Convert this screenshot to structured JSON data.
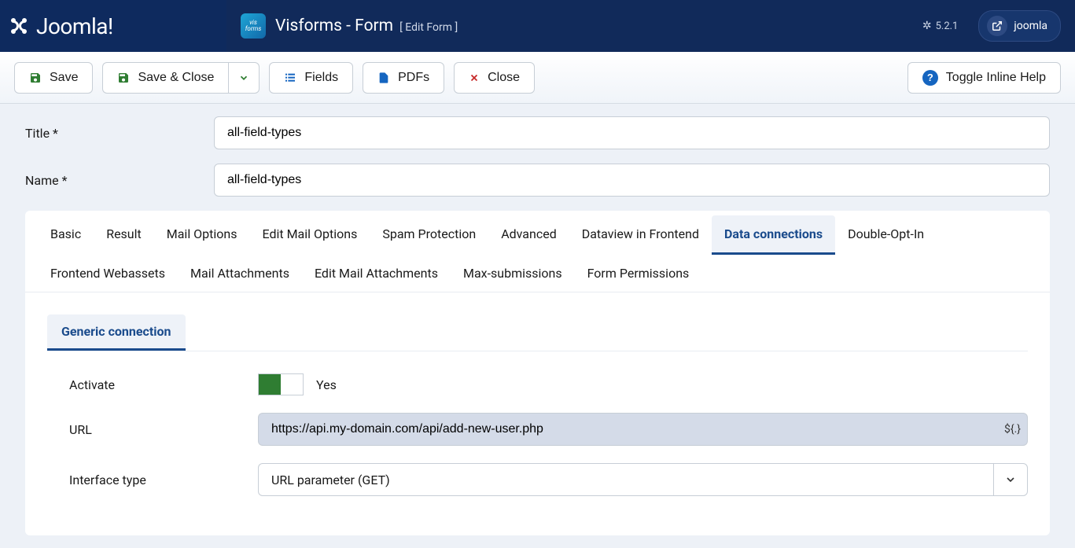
{
  "header": {
    "brand": "Joomla!",
    "title": "Visforms - Form",
    "subtitle": "[ Edit Form ]",
    "version": "5.2.1",
    "site_name": "joomla"
  },
  "toolbar": {
    "save": "Save",
    "save_close": "Save & Close",
    "fields": "Fields",
    "pdfs": "PDFs",
    "close": "Close",
    "toggle_help": "Toggle Inline Help"
  },
  "form": {
    "title_label": "Title *",
    "title_value": "all-field-types",
    "name_label": "Name *",
    "name_value": "all-field-types"
  },
  "tabs": [
    "Basic",
    "Result",
    "Mail Options",
    "Edit Mail Options",
    "Spam Protection",
    "Advanced",
    "Dataview in Frontend",
    "Data connections",
    "Double-Opt-In",
    "Frontend Webassets",
    "Mail Attachments",
    "Edit Mail Attachments",
    "Max-submissions",
    "Form Permissions"
  ],
  "active_tab_index": 7,
  "subtabs": [
    "Generic connection"
  ],
  "active_subtab_index": 0,
  "panel": {
    "activate_label": "Activate",
    "activate_value": "Yes",
    "url_label": "URL",
    "url_value": "https://api.my-domain.com/api/add-new-user.php",
    "url_addon": "${.}",
    "interface_label": "Interface type",
    "interface_value": "URL parameter (GET)"
  }
}
